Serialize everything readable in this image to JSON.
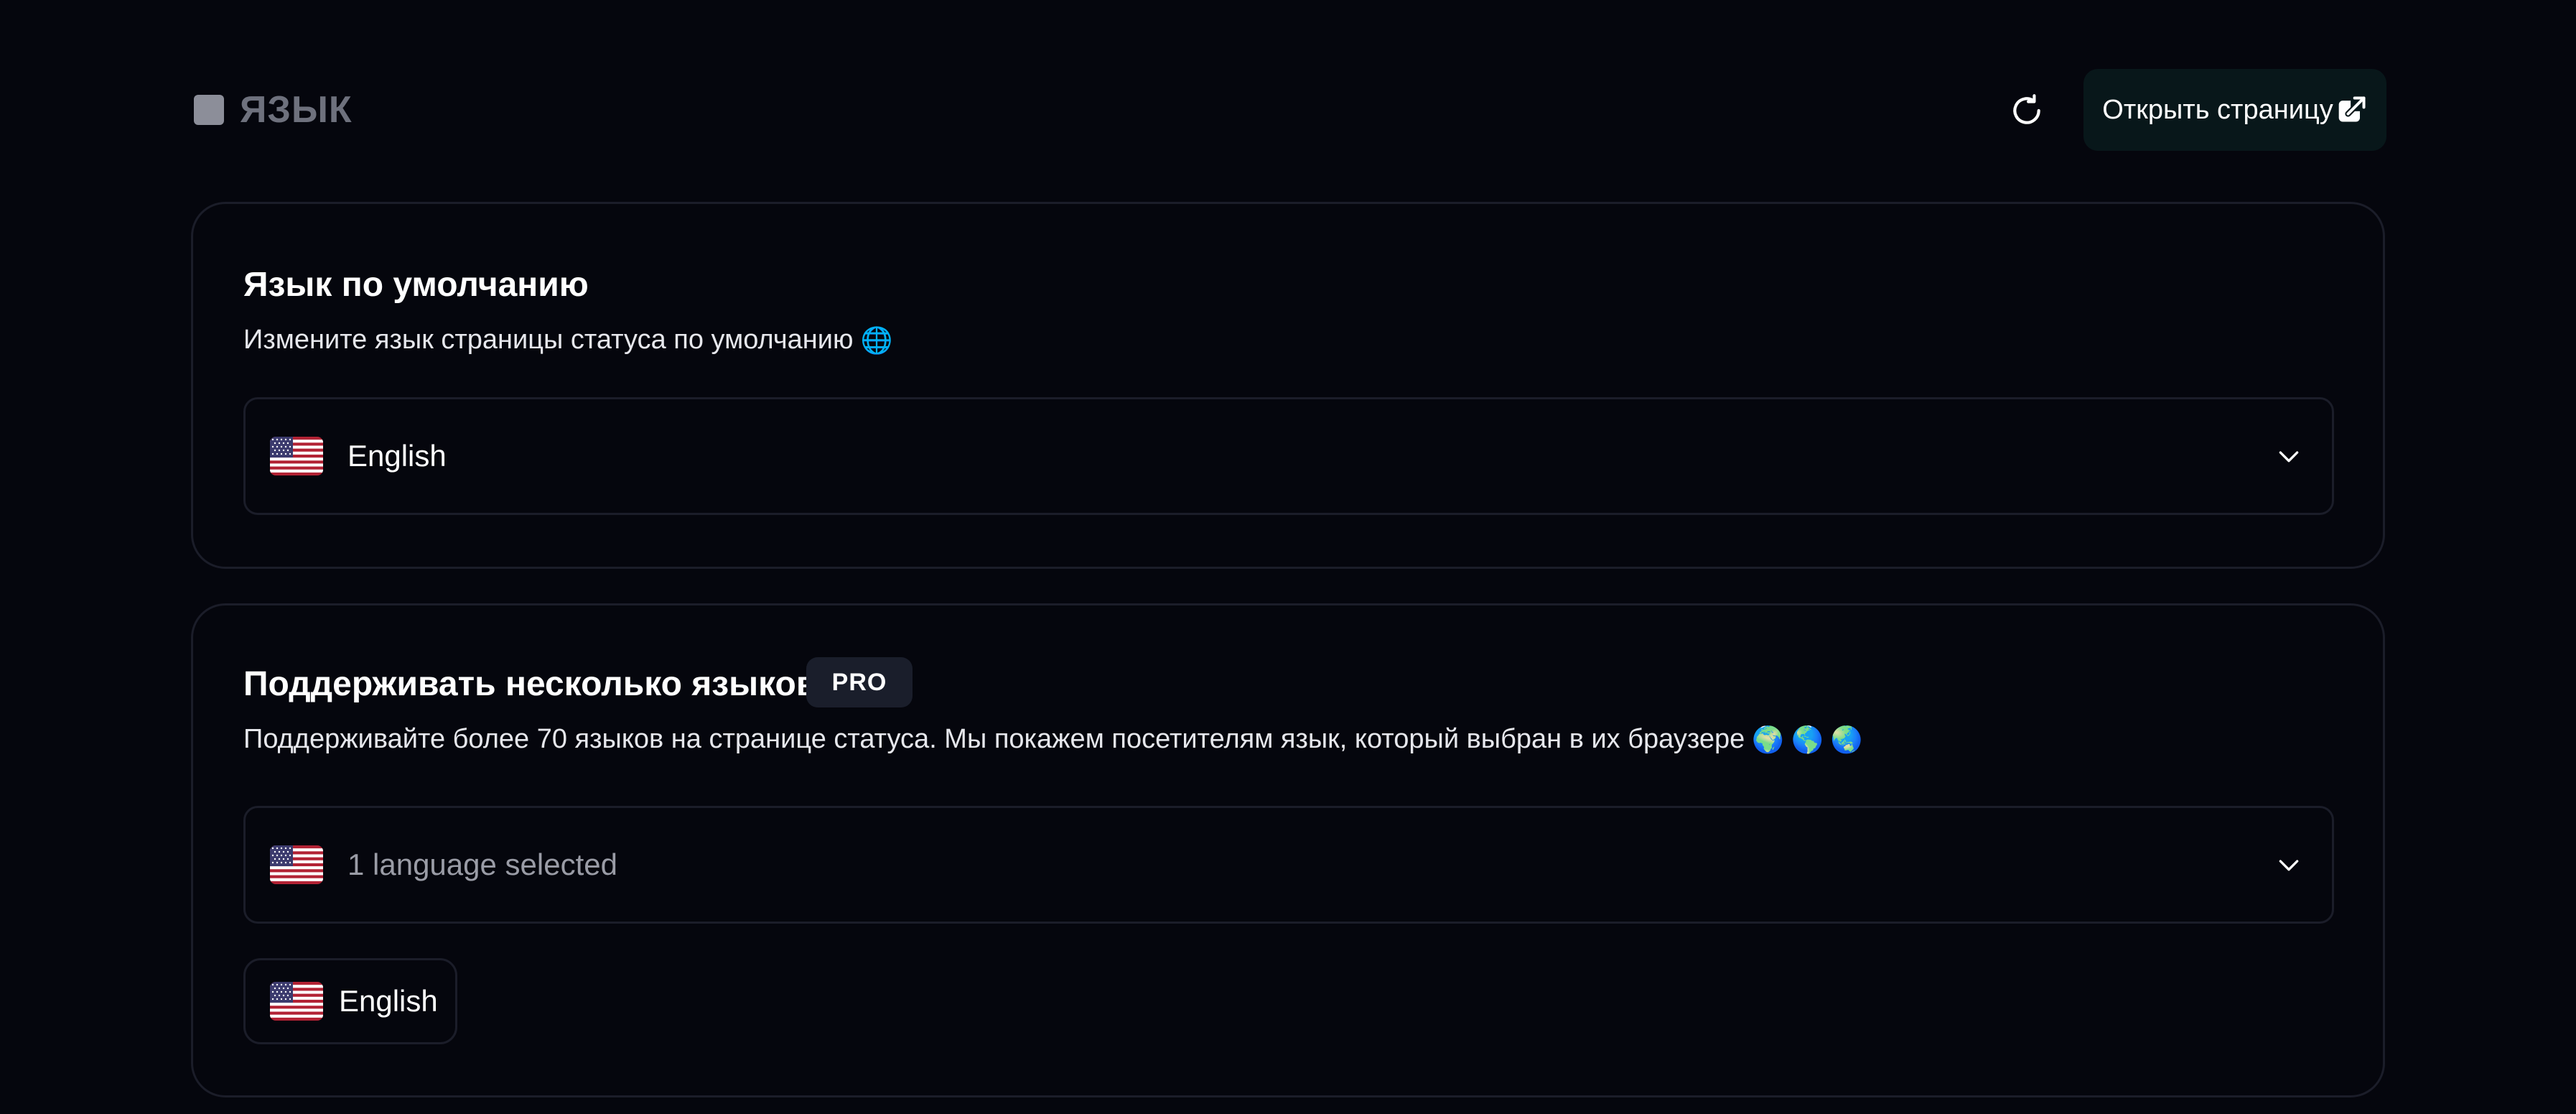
{
  "header": {
    "title": "ЯЗЫК",
    "open_button_label": "Открыть страницу",
    "refresh_icon": "refresh-icon",
    "external_link_icon": "external-link-icon"
  },
  "default_language": {
    "title": "Язык по умолчанию",
    "description": "Измените язык страницы статуса по умолчанию",
    "description_emoji": "🌐",
    "selected_value": "English",
    "selected_flag": "us-flag-icon"
  },
  "multi_language": {
    "title": "Поддерживать несколько языков",
    "badge": "PRO",
    "description": "Поддерживайте более 70 языков на странице статуса. Мы покажем посетителям язык, который выбран в их браузере",
    "description_emojis": "🌍 🌎 🌏",
    "select_value": "1 language selected",
    "selected_chips": [
      {
        "label": "English",
        "flag": "us-flag-icon"
      }
    ]
  },
  "colors": {
    "background": "#05060d",
    "border": "#1b1d29",
    "button_bg": "#08171a",
    "badge_bg": "#1a1e2b",
    "muted_text": "#9a9ca6"
  }
}
